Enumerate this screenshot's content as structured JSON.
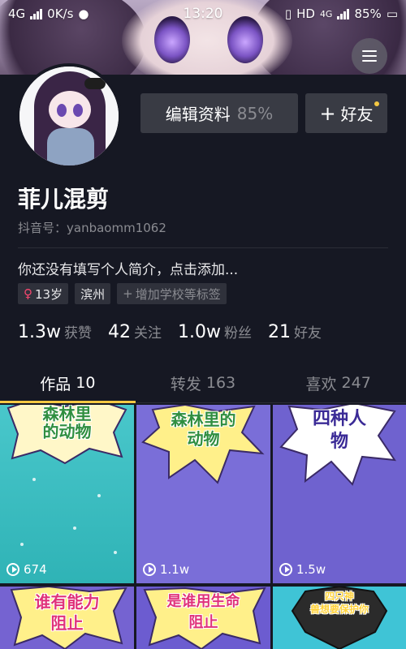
{
  "status_bar": {
    "network": "4G",
    "speed": "0K/s",
    "time": "13:20",
    "hd": "HD",
    "hd_network": "4G",
    "battery": "85%"
  },
  "profile": {
    "name": "菲儿混剪",
    "id_label": "抖音号：",
    "id_value": "yanbaomm1062",
    "bio": "你还没有填写个人简介，点击添加...",
    "edit_button": "编辑资料",
    "edit_percent": "85%",
    "friend_button": "好友",
    "tags": {
      "age": "13岁",
      "city": "滨州",
      "add_school": "增加学校等标签"
    },
    "stats": [
      {
        "num": "1.3w",
        "label": "获赞"
      },
      {
        "num": "42",
        "label": "关注"
      },
      {
        "num": "1.0w",
        "label": "粉丝"
      },
      {
        "num": "21",
        "label": "好友"
      }
    ]
  },
  "tabs": [
    {
      "label": "作品",
      "count": "10"
    },
    {
      "label": "转发",
      "count": "163"
    },
    {
      "label": "喜欢",
      "count": "247"
    }
  ],
  "videos": [
    {
      "title_1": "森林里",
      "title_2": "的动物",
      "plays": "674"
    },
    {
      "title_1": "森林里的",
      "title_2": "动物",
      "plays": "1.1w"
    },
    {
      "title_1": "四种人",
      "title_2": "物",
      "plays": "1.5w"
    },
    {
      "title_1": "谁有能力",
      "title_2": "阻止",
      "plays": ""
    },
    {
      "title_1": "是谁用生命",
      "title_2": "阻止",
      "plays": ""
    },
    {
      "title_1": "四只神",
      "title_2": "兽想要保护你",
      "plays": ""
    }
  ],
  "colors": {
    "background": "#161823",
    "accent": "#f4c843",
    "muted": "#8a8b91",
    "female": "#f7476f"
  },
  "icons": [
    "signal-icon",
    "hd-icon",
    "battery-icon",
    "menu-icon",
    "female-icon",
    "plus-icon",
    "play-icon"
  ]
}
